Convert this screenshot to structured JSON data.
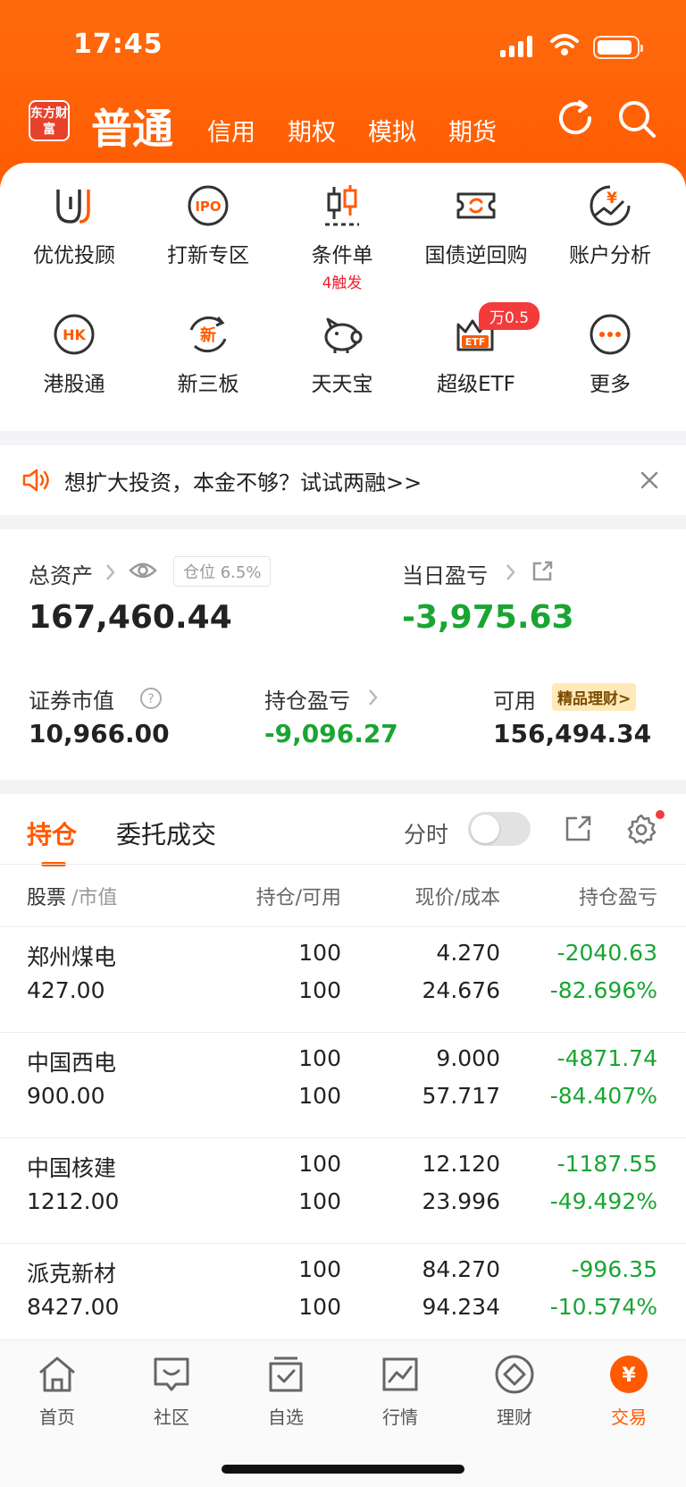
{
  "status_bar": {
    "time": "17:45"
  },
  "header": {
    "logo_text": "东方财富",
    "active_tab": "普通",
    "tabs": [
      "信用",
      "期权",
      "模拟",
      "期货"
    ]
  },
  "quick_items": [
    {
      "label": "优优投顾",
      "sub": ""
    },
    {
      "label": "打新专区",
      "sub": "",
      "icon_text": "IPO"
    },
    {
      "label": "条件单",
      "sub": "4触发"
    },
    {
      "label": "国债逆回购",
      "sub": ""
    },
    {
      "label": "账户分析",
      "sub": "",
      "icon_text": "¥"
    },
    {
      "label": "港股通",
      "sub": "",
      "icon_text": "HK"
    },
    {
      "label": "新三板",
      "sub": "",
      "icon_text": "新"
    },
    {
      "label": "天天宝",
      "sub": ""
    },
    {
      "label": "超级ETF",
      "sub": "",
      "icon_text": "ETF"
    },
    {
      "label": "更多",
      "sub": ""
    }
  ],
  "etf_badge": "万0.5",
  "notice": {
    "text": "想扩大投资，本金不够？试试两融>>"
  },
  "assets": {
    "total_label": "总资产",
    "position_pill": "仓位 6.5%",
    "total_value": "167,460.44",
    "daily_label": "当日盈亏",
    "daily_value": "-3,975.63",
    "market_label": "证券市值",
    "market_value": "10,966.00",
    "holding_label": "持仓盈亏",
    "holding_value": "-9,096.27",
    "avail_label": "可用",
    "avail_badge": "精品理财>",
    "avail_value": "156,494.34"
  },
  "positions": {
    "tab_active": "持仓",
    "tab_other": "委托成交",
    "timeshare_label": "分时",
    "columns": {
      "c1a": "股票",
      "c1b": "/市值",
      "c2": "持仓/可用",
      "c3": "现价/成本",
      "c4": "持仓盈亏"
    },
    "rows": [
      {
        "name": "郑州煤电",
        "mv": "427.00",
        "hold": "100",
        "avail": "100",
        "price": "4.270",
        "cost": "24.676",
        "pnl": "-2040.63",
        "pct": "-82.696%"
      },
      {
        "name": "中国西电",
        "mv": "900.00",
        "hold": "100",
        "avail": "100",
        "price": "9.000",
        "cost": "57.717",
        "pnl": "-4871.74",
        "pct": "-84.407%"
      },
      {
        "name": "中国核建",
        "mv": "1212.00",
        "hold": "100",
        "avail": "100",
        "price": "12.120",
        "cost": "23.996",
        "pnl": "-1187.55",
        "pct": "-49.492%"
      },
      {
        "name": "派克新材",
        "mv": "8427.00",
        "hold": "100",
        "avail": "100",
        "price": "84.270",
        "cost": "94.234",
        "pnl": "-996.35",
        "pct": "-10.574%"
      }
    ]
  },
  "tabbar": [
    {
      "label": "首页",
      "icon": "home-icon"
    },
    {
      "label": "社区",
      "icon": "community-icon"
    },
    {
      "label": "自选",
      "icon": "watchlist-icon"
    },
    {
      "label": "行情",
      "icon": "market-icon"
    },
    {
      "label": "理财",
      "icon": "wealth-icon"
    },
    {
      "label": "交易",
      "icon": "trade-icon"
    }
  ],
  "colors": {
    "brand": "#ff5a00",
    "loss": "#1aa533",
    "badge": "#f33b3b"
  }
}
